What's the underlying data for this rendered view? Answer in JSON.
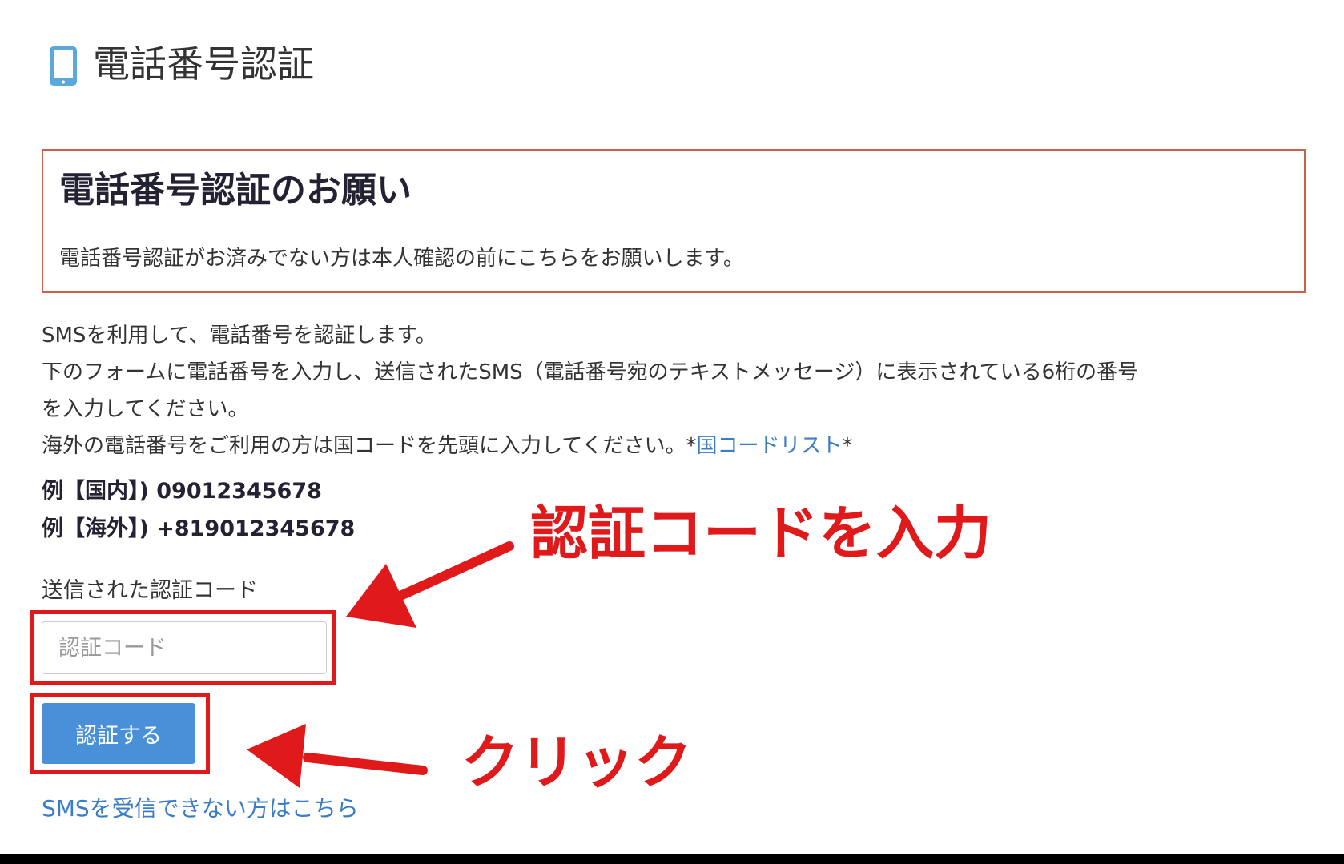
{
  "header": {
    "title": "電話番号認証",
    "icon": "smartphone-icon"
  },
  "notice": {
    "heading": "電話番号認証のお願い",
    "text": "電話番号認証がお済みでない方は本人確認の前にこちらをお願いします。",
    "border_color": "#c9604b"
  },
  "instructions": {
    "line1": "SMSを利用して、電話番号を認証します。",
    "line2": "下のフォームに電話番号を入力し、送信されたSMS（電話番号宛のテキストメッセージ）に表示されている6桁の番号",
    "line3": "を入力してください。",
    "line4_prefix": "海外の電話番号をご利用の方は国コードを先頭に入力してください。*",
    "line4_link": "国コードリスト",
    "line4_suffix": "*"
  },
  "examples": {
    "domestic": "例【国内】) 09012345678",
    "overseas": "例【海外】) +819012345678"
  },
  "form": {
    "code_label": "送信された認証コード",
    "code_value": "",
    "code_placeholder": "認証コード",
    "submit_label": "認証する"
  },
  "links": {
    "sms_not_received": "SMSを受信できない方はこちら"
  },
  "annotations": {
    "enter_code": "認証コードを入力",
    "click": "クリック",
    "color": "#e0191b"
  },
  "colors": {
    "accent": "#4a90d9",
    "link": "#3a7cc5",
    "icon": "#5aa8dc"
  }
}
